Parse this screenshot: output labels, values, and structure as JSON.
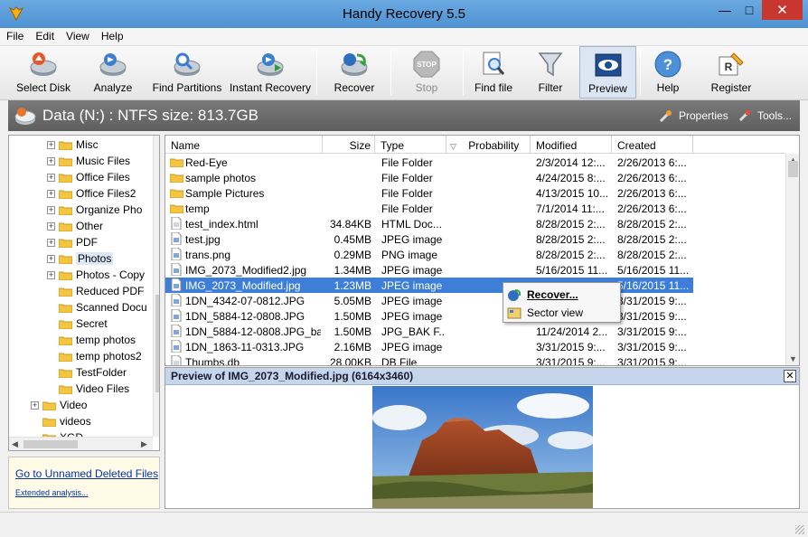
{
  "window": {
    "title": "Handy Recovery 5.5"
  },
  "menu": [
    "File",
    "Edit",
    "View",
    "Help"
  ],
  "toolbar": {
    "select_disk": "Select Disk",
    "analyze": "Analyze",
    "find_partitions": "Find Partitions",
    "instant_recovery": "Instant Recovery",
    "recover": "Recover",
    "stop": "Stop",
    "find_file": "Find file",
    "filter": "Filter",
    "preview": "Preview",
    "help": "Help",
    "register": "Register"
  },
  "disk": {
    "title": "Data (N:) : NTFS size: 813.7GB",
    "properties": "Properties",
    "tools": "Tools..."
  },
  "tree": {
    "items": [
      "Misc",
      "Music Files",
      "Office Files",
      "Office Files2",
      "Organize Pho",
      "Other",
      "PDF",
      "Photos",
      "Photos - Copy",
      "Reduced PDF",
      "Scanned Docu",
      "Secret",
      "temp photos",
      "temp photos2",
      "TestFolder",
      "Video Files",
      "Video",
      "videos",
      "XGD..."
    ],
    "selected": "Photos"
  },
  "links": {
    "unnamed": "Go to Unnamed Deleted Files",
    "extended": "Extended analysis..."
  },
  "list": {
    "columns": {
      "name": "Name",
      "size": "Size",
      "type": "Type",
      "probability": "Probability",
      "modified": "Modified",
      "created": "Created"
    },
    "rows": [
      {
        "name": "Red-Eye",
        "size": "",
        "type": "File Folder",
        "modified": "2/3/2014 12:...",
        "created": "2/26/2013 6:..."
      },
      {
        "name": "sample photos",
        "size": "",
        "type": "File Folder",
        "modified": "4/24/2015 8:...",
        "created": "2/26/2013 6:..."
      },
      {
        "name": "Sample Pictures",
        "size": "",
        "type": "File Folder",
        "modified": "4/13/2015 10...",
        "created": "2/26/2013 6:..."
      },
      {
        "name": "temp",
        "size": "",
        "type": "File Folder",
        "modified": "7/1/2014 11:...",
        "created": "2/26/2013 6:..."
      },
      {
        "name": "test_index.html",
        "size": "34.84KB",
        "type": "HTML Doc...",
        "modified": "8/28/2015 2:...",
        "created": "8/28/2015 2:..."
      },
      {
        "name": "test.jpg",
        "size": "0.45MB",
        "type": "JPEG image",
        "modified": "8/28/2015 2:...",
        "created": "8/28/2015 2:..."
      },
      {
        "name": "trans.png",
        "size": "0.29MB",
        "type": "PNG image",
        "modified": "8/28/2015 2:...",
        "created": "8/28/2015 2:..."
      },
      {
        "name": "IMG_2073_Modified2.jpg",
        "size": "1.34MB",
        "type": "JPEG image",
        "modified": "5/16/2015 11...",
        "created": "5/16/2015 11..."
      },
      {
        "name": "IMG_2073_Modified.jpg",
        "size": "1.23MB",
        "type": "JPEG image",
        "modified": "",
        "created": "5/16/2015 11..."
      },
      {
        "name": "1DN_4342-07-0812.JPG",
        "size": "5.05MB",
        "type": "JPEG image",
        "modified": "",
        "created": "3/31/2015 9:..."
      },
      {
        "name": "1DN_5884-12-0808.JPG",
        "size": "1.50MB",
        "type": "JPEG image",
        "modified": "",
        "created": "3/31/2015 9:..."
      },
      {
        "name": "1DN_5884-12-0808.JPG_bak",
        "size": "1.50MB",
        "type": "JPG_BAK F...",
        "modified": "11/24/2014 2...",
        "created": "3/31/2015 9:..."
      },
      {
        "name": "1DN_1863-11-0313.JPG",
        "size": "2.16MB",
        "type": "JPEG image",
        "modified": "3/31/2015 9:...",
        "created": "3/31/2015 9:..."
      },
      {
        "name": "Thumbs.db",
        "size": "28.00KB",
        "type": "DB File",
        "modified": "3/31/2015 9:...",
        "created": "3/31/2015 9:..."
      }
    ],
    "selected_index": 8
  },
  "context_menu": {
    "recover": "Recover...",
    "sector_view": "Sector view"
  },
  "preview": {
    "title": "Preview of IMG_2073_Modified.jpg (6164x3460)"
  },
  "colors": {
    "title_bar": "#5b9bd5",
    "selection": "#3d7ed9",
    "disk_bar": "#6b6b6b",
    "folder": "#f5c542"
  }
}
